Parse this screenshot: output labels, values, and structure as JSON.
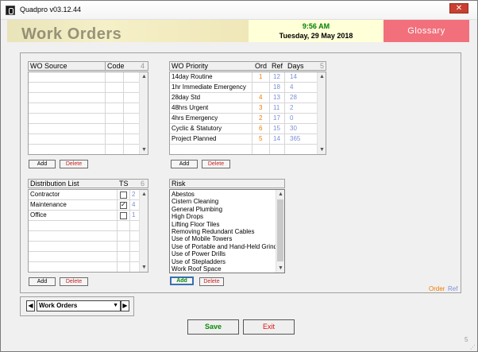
{
  "window": {
    "title": "Quadpro v03.12.44"
  },
  "header": {
    "banner_title": "Work Orders",
    "time": "9:56 AM",
    "date": "Tuesday, 29 May 2018",
    "glossary_label": "Glossary"
  },
  "wo_source": {
    "title": "WO Source",
    "code_label": "Code",
    "count": "4",
    "add_label": "Add",
    "delete_label": "Delete"
  },
  "wo_priority": {
    "title": "WO Priority",
    "ord_label": "Ord",
    "ref_label": "Ref",
    "days_label": "Days",
    "count": "5",
    "rows": [
      {
        "name": "14day Routine",
        "ord": "1",
        "ref": "12",
        "days": "14"
      },
      {
        "name": "1hr Immediate Emergency",
        "ord": "",
        "ref": "18",
        "days": "4"
      },
      {
        "name": "28day Std",
        "ord": "4",
        "ref": "13",
        "days": "28"
      },
      {
        "name": "48hrs Urgent",
        "ord": "3",
        "ref": "11",
        "days": "2"
      },
      {
        "name": "4hrs Emergency",
        "ord": "2",
        "ref": "17",
        "days": "0"
      },
      {
        "name": "Cyclic & Statutory",
        "ord": "6",
        "ref": "15",
        "days": "30"
      },
      {
        "name": "Project Planned",
        "ord": "5",
        "ref": "14",
        "days": "365"
      }
    ],
    "add_label": "Add",
    "delete_label": "Delete"
  },
  "distribution": {
    "title": "Distribution List",
    "ts_label": "TS",
    "count": "6",
    "rows": [
      {
        "name": "Contractor",
        "checked": false,
        "num": "2"
      },
      {
        "name": "Maintenance",
        "checked": true,
        "num": "4"
      },
      {
        "name": "Office",
        "checked": false,
        "num": "1"
      }
    ],
    "add_label": "Add",
    "delete_label": "Delete"
  },
  "risk": {
    "title": "Risk",
    "items": [
      "Abestos",
      "Cistern Cleaning",
      "General Plumbing",
      "High Drops",
      "Lifting Floor Tiles",
      "Removing Redundant Cables",
      "Use of Mobile Towers",
      "Use of Portable and Hand-Held Grind",
      "Use of Power Drills",
      "Use of Stepladders",
      "Work Roof Space"
    ],
    "add_label": "Add",
    "delete_label": "Delete"
  },
  "legend": {
    "order": "Order",
    "ref": "Ref"
  },
  "nav": {
    "selected": "Work Orders"
  },
  "footer": {
    "save_label": "Save",
    "exit_label": "Exit",
    "corner_number": "5"
  },
  "colors": {
    "orange": "#f07d00",
    "blue": "#7a8fd9",
    "glossary": "#f1707c",
    "clock_green": "#008000"
  }
}
